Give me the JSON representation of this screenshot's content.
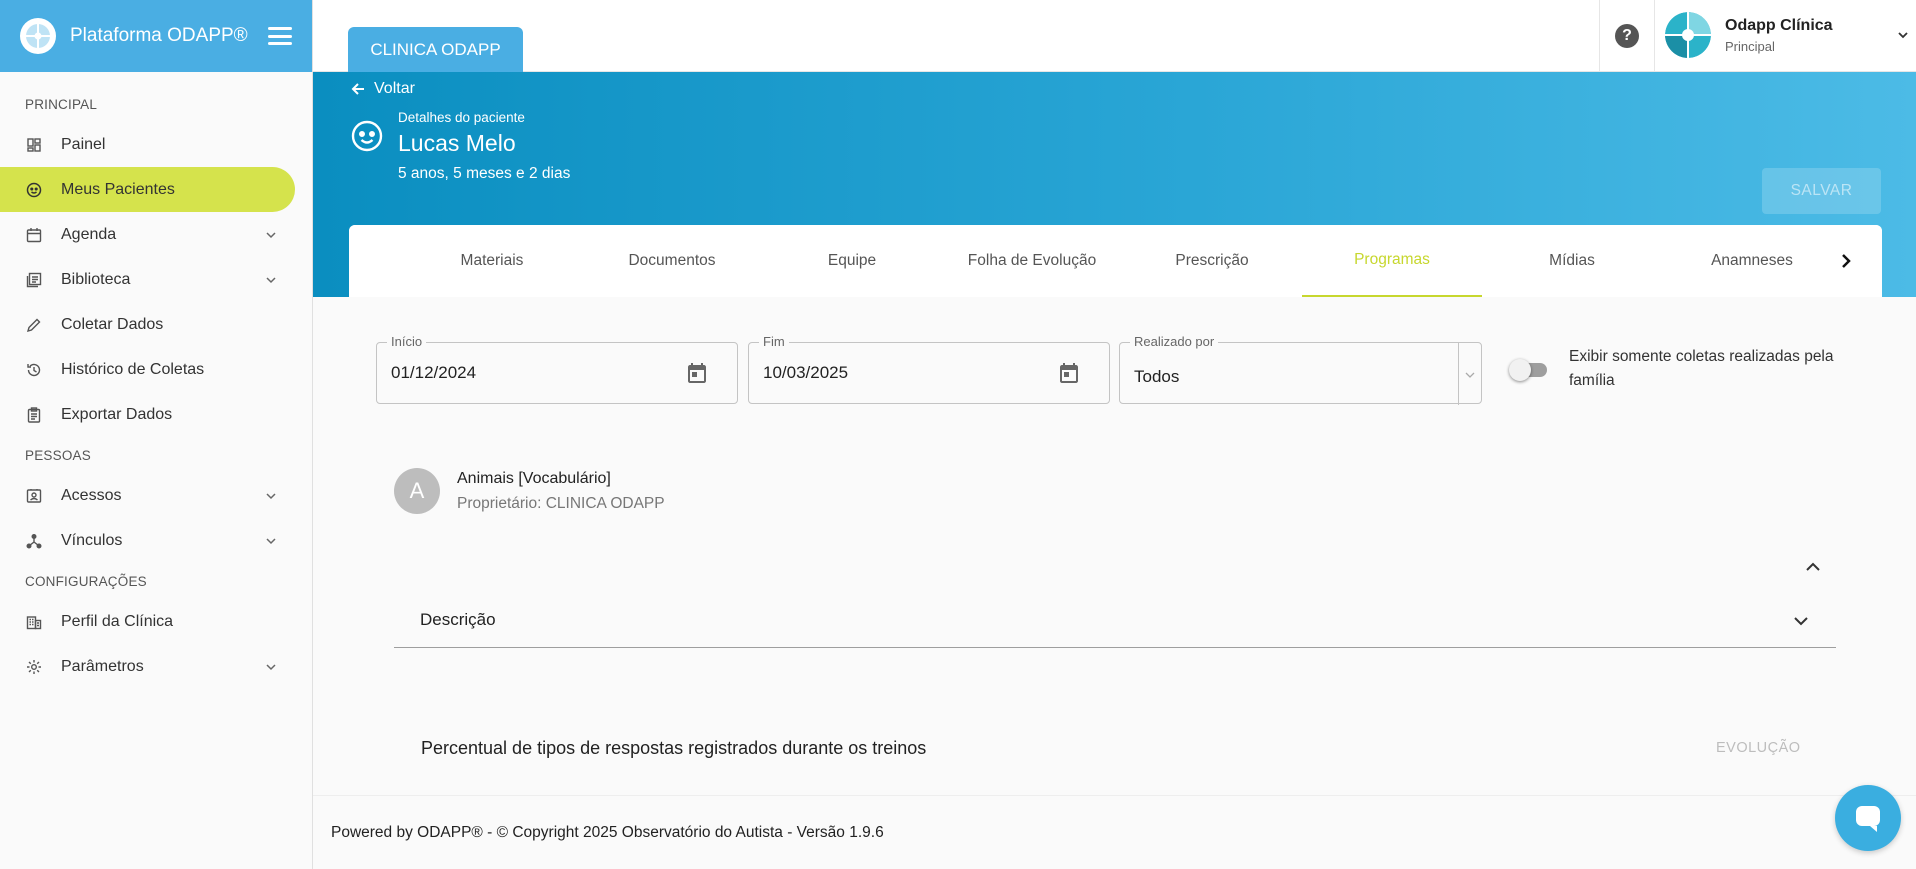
{
  "brand": {
    "title": "Plataforma ODAPP®"
  },
  "sidebar": {
    "sections": [
      {
        "label": "PRINCIPAL"
      },
      {
        "label": "PESSOAS"
      },
      {
        "label": "CONFIGURAÇÕES"
      }
    ],
    "items": [
      {
        "label": "Painel",
        "icon": "dashboard-icon"
      },
      {
        "label": "Meus Pacientes",
        "icon": "face-icon",
        "active": true
      },
      {
        "label": "Agenda",
        "icon": "calendar-icon",
        "expandable": true
      },
      {
        "label": "Biblioteca",
        "icon": "library-icon",
        "expandable": true
      },
      {
        "label": "Coletar Dados",
        "icon": "pencil-icon"
      },
      {
        "label": "Histórico de Coletas",
        "icon": "history-icon"
      },
      {
        "label": "Exportar Dados",
        "icon": "clipboard-icon"
      },
      {
        "label": "Acessos",
        "icon": "badge-icon",
        "expandable": true
      },
      {
        "label": "Vínculos",
        "icon": "share-icon",
        "expandable": true
      },
      {
        "label": "Perfil da Clínica",
        "icon": "building-icon"
      },
      {
        "label": "Parâmetros",
        "icon": "gear-icon",
        "expandable": true
      }
    ]
  },
  "topbar": {
    "clinic_tab": "CLINICA ODAPP",
    "help_icon": "?",
    "user": {
      "name": "Odapp Clínica",
      "role": "Principal"
    }
  },
  "hero": {
    "back_label": "Voltar",
    "subtitle": "Detalhes do paciente",
    "patient_name": "Lucas Melo",
    "patient_age": "5 anos, 5 meses e 2 dias",
    "save_label": "SALVAR"
  },
  "tabs": [
    {
      "label": "Materiais"
    },
    {
      "label": "Documentos"
    },
    {
      "label": "Equipe"
    },
    {
      "label": "Folha de Evolução"
    },
    {
      "label": "Prescrição"
    },
    {
      "label": "Programas",
      "active": true
    },
    {
      "label": "Mídias"
    },
    {
      "label": "Anamneses"
    }
  ],
  "filters": {
    "start": {
      "label": "Início",
      "value": "01/12/2024"
    },
    "end": {
      "label": "Fim",
      "value": "10/03/2025"
    },
    "performed_by": {
      "label": "Realizado por",
      "value": "Todos"
    },
    "family_only": {
      "label": "Exibir somente coletas realizadas pela família",
      "checked": false
    }
  },
  "program": {
    "avatar_letter": "A",
    "title": "Animais [Vocabulário]",
    "owner": "Proprietário: CLINICA ODAPP"
  },
  "description": {
    "label": "Descrição"
  },
  "percent_section": {
    "title": "Percentual de tipos de respostas registrados durante os treinos",
    "evolucao_label": "EVOLUÇÃO"
  },
  "footer": {
    "text": "Powered by ODAPP® - © Copyright 2025 Observatório do Autista - Versão 1.9.6"
  },
  "colors": {
    "primary": "#4aaee3",
    "accent": "#d5e34c",
    "active_tab": "#c7d72e"
  }
}
